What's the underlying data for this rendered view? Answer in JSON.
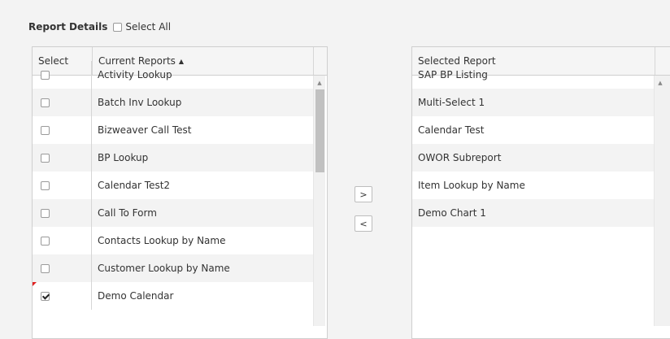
{
  "header": {
    "title": "Report Details",
    "select_all_label": "Select All",
    "select_all_checked": false
  },
  "current_grid": {
    "col_select": "Select",
    "col_name": "Current Reports",
    "sort_icon": "sort-ascending-icon",
    "rows": [
      {
        "name": "Activity Lookup",
        "checked": false
      },
      {
        "name": "Batch Inv Lookup",
        "checked": false
      },
      {
        "name": "Bizweaver Call Test",
        "checked": false
      },
      {
        "name": "BP Lookup",
        "checked": false
      },
      {
        "name": "Calendar Test2",
        "checked": false
      },
      {
        "name": "Call To Form",
        "checked": false
      },
      {
        "name": "Contacts Lookup by Name",
        "checked": false
      },
      {
        "name": "Customer Lookup by Name",
        "checked": false
      },
      {
        "name": "Demo Calendar",
        "checked": true
      }
    ]
  },
  "buttons": {
    "add_label": ">",
    "remove_label": "<"
  },
  "selected_grid": {
    "col_name": "Selected Report",
    "rows": [
      {
        "name": "SAP BP Listing"
      },
      {
        "name": "Multi-Select 1"
      },
      {
        "name": "Calendar Test"
      },
      {
        "name": "OWOR Subreport"
      },
      {
        "name": "Item Lookup by Name"
      },
      {
        "name": "Demo Chart 1"
      }
    ]
  },
  "colors": {
    "background": "#f3f3f3",
    "alt_row": "#f3f3f3",
    "dirty_marker": "#e02020"
  }
}
